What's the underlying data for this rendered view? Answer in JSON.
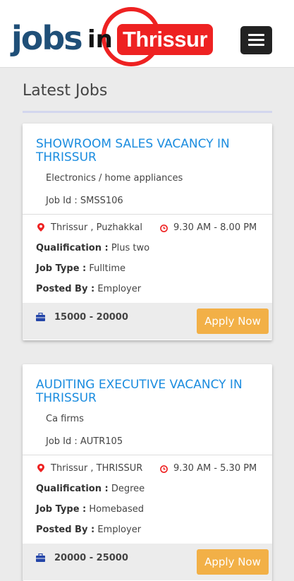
{
  "header": {
    "logo_jobs": "jobs",
    "logo_in": "in",
    "logo_city": "Thrissur",
    "brand_colors": {
      "primary": "#1f4f78",
      "accent": "#e22222"
    }
  },
  "section": {
    "title": "Latest Jobs"
  },
  "jobs": [
    {
      "title": "SHOWROOM SALES VACANCY IN THRISSUR",
      "category": "Electronics / home appliances",
      "job_id": "Job Id : SMSS106",
      "location": "Thrissur , Puzhakkal",
      "timing": "9.30 AM - 8.00 PM",
      "qualification_label": "Qualification :",
      "qualification": "Plus two",
      "job_type_label": "Job Type :",
      "job_type": "Fulltime",
      "posted_by_label": "Posted By :",
      "posted_by": "Employer",
      "salary": "15000 - 20000",
      "apply_label": "Apply Now"
    },
    {
      "title": "AUDITING EXECUTIVE VACANCY IN THRISSUR",
      "category": "Ca firms",
      "job_id": "Job Id : AUTR105",
      "location": "Thrissur , THRISSUR",
      "timing": "9.30 AM - 5.30 PM",
      "qualification_label": "Qualification :",
      "qualification": "Degree",
      "job_type_label": "Job Type :",
      "job_type": "Homebased",
      "posted_by_label": "Posted By :",
      "posted_by": "Employer",
      "salary": "20000 - 25000",
      "apply_label": "Apply Now"
    }
  ],
  "icons": {
    "location": "map-marker-icon",
    "time": "clock-icon",
    "salary": "briefcase-icon",
    "menu": "hamburger-menu-icon"
  }
}
